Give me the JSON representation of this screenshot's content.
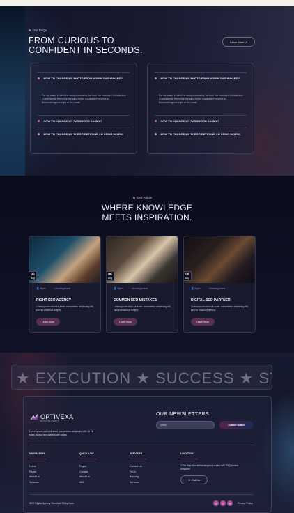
{
  "faq": {
    "eyebrow": "Our FAQs",
    "title_line1": "FROM CURIOUS TO",
    "title_line2": "CONFIDENT IN SECONDS.",
    "learn_more": "Learn More",
    "columns": [
      {
        "q1": "HOW TO CHANGE MY PHOTO FROM ADMIN DASHBOARD?",
        "answer": "Far far away, behind the word mountains, far from the countries Vokalia and Consonantia, there live the blind texts. Separated they live in Bookmarksgrove right at the coast",
        "q2": "HOW TO CHANGE MY PASSWORD EASILY?",
        "q3": "HOW TO CHANGE MY SUBSCRIPTION PLAN USING PAYPAL"
      },
      {
        "q1": "HOW TO CHANGE MY PHOTO FROM ADMIN DASHBOARD?",
        "answer": "Far far away, behind the word mountains, far from the countries Vokalia and Consonantia, there live the blind texts. Separated they live in Bookmarksgrove right at the coast",
        "q2": "HOW TO CHANGE MY PASSWORD EASILY?",
        "q3": "HOW TO CHANGE MY SUBSCRIPTION PLAN USING PAYPAL"
      }
    ]
  },
  "articles": {
    "eyebrow": "Our Article",
    "title_line1": "WHERE KNOWLEDGE",
    "title_line2": "MEETS INSPIRATION.",
    "posts": [
      {
        "day": "06",
        "month": "Aug",
        "author": "Mpm",
        "category": "Uncategorized",
        "title": "RIGHT SEO AGENCY",
        "text": "Lorem ipsum dolor sit amet, consectetur adipiscing elit, sed do eiusmod tempor.",
        "button": "Learn more"
      },
      {
        "day": "06",
        "month": "Aug",
        "author": "Mpm",
        "category": "Uncategorized",
        "title": "COMMON SEO MISTAKES",
        "text": "Lorem ipsum dolor sit amet, consectetur adipiscing elit, sed do eiusmod tempor.",
        "button": "Learn more"
      },
      {
        "day": "06",
        "month": "Aug",
        "author": "Mpm",
        "category": "Uncategorized",
        "title": "DIGITAL SEO PARTNER",
        "text": "Lorem ipsum dolor sit amet, consectetur adipiscing elit, sed do eiusmod tempor.",
        "button": "Learn more"
      }
    ]
  },
  "marquee": {
    "text": "★ EXECUTION ★ SUCCESS ★ STI"
  },
  "footer": {
    "brand": "OPTIVEXA",
    "tagline": "SEO DIGITAL AGENCY",
    "about": "Lorem ipsum dolor sit amet, consectetur adipiscing elit. Ut elit tellus, luctus nec ullamcorper mattis.",
    "newsletter_title": "OUR NEWSLETTERS",
    "email_placeholder": "Email",
    "subscribe": "Submit button",
    "columns": [
      {
        "title": "NAVIGATION",
        "items": [
          "Home",
          "Pages",
          "About Us",
          "Services"
        ]
      },
      {
        "title": "QUICK LINK",
        "items": [
          "Pages",
          "Contact",
          "About Us",
          "404"
        ]
      },
      {
        "title": "SERVICES",
        "items": [
          "Contact Us",
          "FAQs",
          "Booking",
          "Services"
        ]
      }
    ],
    "location_title": "LOCATION",
    "address": "1735 High Street Kensington London W8 7NQ United Kingdom",
    "call": "Call Us",
    "copyright": "SEO Digital Agency Template Kit by Mpm",
    "privacy": "Privacy Policy",
    "social": [
      "G",
      "Y",
      "In"
    ]
  },
  "colors": {
    "accent": "#c56fb2",
    "button": "#57304f",
    "background": "#0c0d1d"
  }
}
